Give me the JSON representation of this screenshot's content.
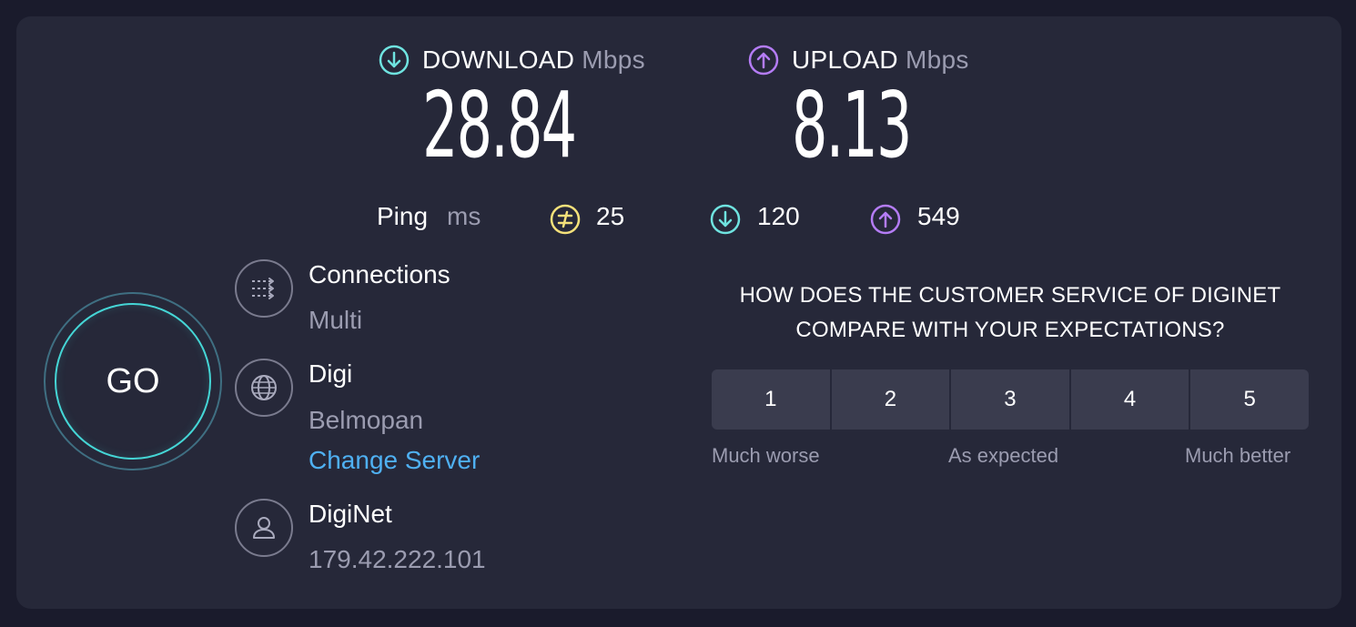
{
  "download": {
    "label": "DOWNLOAD",
    "unit": "Mbps",
    "value": "28.84",
    "icon": "arrow-down-circle-icon",
    "color": "#6fe3e0"
  },
  "upload": {
    "label": "UPLOAD",
    "unit": "Mbps",
    "value": "8.13",
    "icon": "arrow-up-circle-icon",
    "color": "#b47cf5"
  },
  "ping": {
    "label": "Ping",
    "unit": "ms",
    "idle": {
      "value": "25",
      "icon": "jitter-icon",
      "color": "#f5e17a"
    },
    "download": {
      "value": "120",
      "icon": "arrow-down-circle-icon",
      "color": "#6fe3e0"
    },
    "upload": {
      "value": "549",
      "icon": "arrow-up-circle-icon",
      "color": "#b47cf5"
    }
  },
  "go_button": {
    "label": "GO"
  },
  "connections": {
    "title": "Connections",
    "value": "Multi",
    "icon": "connections-icon"
  },
  "server": {
    "title": "Digi",
    "location": "Belmopan",
    "change_link": "Change Server",
    "icon": "globe-icon"
  },
  "provider": {
    "title": "DigiNet",
    "ip": "179.42.222.101",
    "icon": "user-icon"
  },
  "survey": {
    "question_line1": "HOW DOES THE CUSTOMER SERVICE OF DIGINET",
    "question_line2": "COMPARE WITH YOUR EXPECTATIONS?",
    "options": [
      "1",
      "2",
      "3",
      "4",
      "5"
    ],
    "low_label": "Much worse",
    "mid_label": "As expected",
    "high_label": "Much better"
  }
}
